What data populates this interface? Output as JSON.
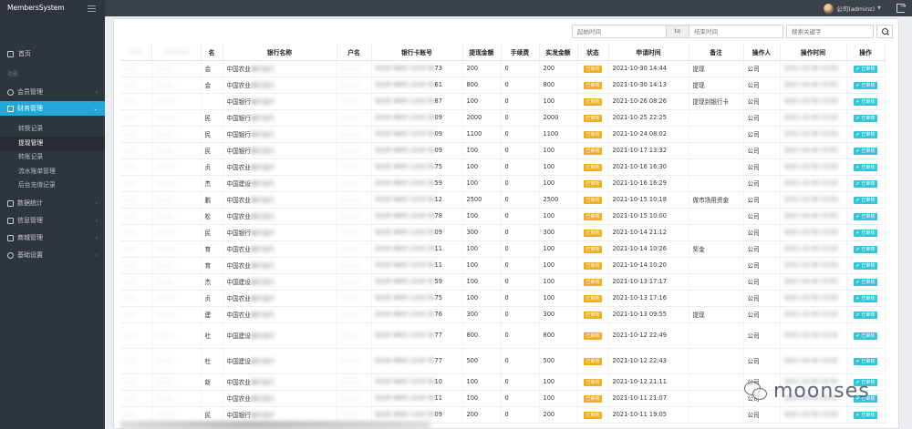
{
  "app": {
    "logo_text": "MembersSystem",
    "user_name": "公司(adminz)"
  },
  "sidebar": {
    "home": "首页",
    "section_label": "功能",
    "items": [
      {
        "label": "会员管理"
      },
      {
        "label": "财务管理"
      },
      {
        "label": "数据统计"
      },
      {
        "label": "信息管理"
      },
      {
        "label": "商城管理"
      },
      {
        "label": "基础设置"
      }
    ],
    "sub_items": [
      {
        "label": "转换记录"
      },
      {
        "label": "提现管理"
      },
      {
        "label": "转账记录"
      },
      {
        "label": "流水账单管理"
      },
      {
        "label": "后台充值记录"
      }
    ]
  },
  "filters": {
    "start_placeholder": "起始时间",
    "separator": "to",
    "end_placeholder": "结束时间",
    "keyword_placeholder": "搜索关键字"
  },
  "table": {
    "headers": {
      "name_tail": "名",
      "bank_name": "银行名称",
      "account_name": "户名",
      "card_no": "银行卡账号",
      "amount": "提现金额",
      "fee": "手续费",
      "actual": "实发金额",
      "status": "状态",
      "apply_time": "申请时间",
      "remark": "备注",
      "operator": "操作人",
      "op_time": "操作时间",
      "action": "操作"
    },
    "status_badge": "已审核",
    "action_label": "✔ 已审核",
    "rows": [
      {
        "name_tail": "会",
        "bank": "中国农业",
        "card_tail": "73",
        "amount": "200",
        "fee": "0",
        "actual": "200",
        "apply_time": "2021-10-30 14:44",
        "remark": "提现",
        "operator": "公司"
      },
      {
        "name_tail": "会",
        "bank": "中国农业",
        "card_tail": "61",
        "amount": "800",
        "fee": "0",
        "actual": "800",
        "apply_time": "2021-10-30 14:13",
        "remark": "提现",
        "operator": "公司"
      },
      {
        "name_tail": "",
        "bank": "中国银行",
        "card_tail": "87",
        "amount": "100",
        "fee": "0",
        "actual": "100",
        "apply_time": "2021-10-26 08:26",
        "remark": "提现到银行卡",
        "operator": "公司"
      },
      {
        "name_tail": "民",
        "bank": "中国银行",
        "card_tail": "09",
        "amount": "2000",
        "fee": "0",
        "actual": "2000",
        "apply_time": "2021-10-25 22:25",
        "remark": "",
        "operator": "公司"
      },
      {
        "name_tail": "民",
        "bank": "中国银行",
        "card_tail": "09",
        "amount": "1100",
        "fee": "0",
        "actual": "1100",
        "apply_time": "2021-10-24 08:02",
        "remark": "",
        "operator": "公司"
      },
      {
        "name_tail": "民",
        "bank": "中国银行",
        "card_tail": "09",
        "amount": "100",
        "fee": "0",
        "actual": "100",
        "apply_time": "2021-10-17 13:32",
        "remark": "",
        "operator": "公司"
      },
      {
        "name_tail": "贞",
        "bank": "中国农业",
        "card_tail": "75",
        "amount": "100",
        "fee": "0",
        "actual": "100",
        "apply_time": "2021-10-16 16:30",
        "remark": "",
        "operator": "公司"
      },
      {
        "name_tail": "杰",
        "bank": "中国建设",
        "card_tail": "59",
        "amount": "100",
        "fee": "0",
        "actual": "100",
        "apply_time": "2021-10-16 16:29",
        "remark": "",
        "operator": "公司"
      },
      {
        "name_tail": "鹏",
        "bank": "中国农业",
        "card_tail": "12",
        "amount": "2500",
        "fee": "0",
        "actual": "2500",
        "apply_time": "2021-10-15 10:18",
        "remark": "做市场用资金",
        "operator": "公司"
      },
      {
        "name_tail": "松",
        "bank": "中国农业",
        "card_tail": "78",
        "amount": "100",
        "fee": "0",
        "actual": "100",
        "apply_time": "2021-10-15 10:00",
        "remark": "",
        "operator": "公司"
      },
      {
        "name_tail": "民",
        "bank": "中国银行",
        "card_tail": "09",
        "amount": "300",
        "fee": "0",
        "actual": "300",
        "apply_time": "2021-10-14 21:12",
        "remark": "",
        "operator": "公司"
      },
      {
        "name_tail": "育",
        "bank": "中国农业",
        "card_tail": "11",
        "amount": "100",
        "fee": "0",
        "actual": "100",
        "apply_time": "2021-10-14 10:26",
        "remark": "奖金",
        "operator": "公司"
      },
      {
        "name_tail": "育",
        "bank": "中国农业",
        "card_tail": "11",
        "amount": "100",
        "fee": "0",
        "actual": "100",
        "apply_time": "2021-10-14 10:20",
        "remark": "",
        "operator": "公司"
      },
      {
        "name_tail": "杰",
        "bank": "中国建设",
        "card_tail": "59",
        "amount": "100",
        "fee": "0",
        "actual": "100",
        "apply_time": "2021-10-13 17:17",
        "remark": "",
        "operator": "公司"
      },
      {
        "name_tail": "贞",
        "bank": "中国农业",
        "card_tail": "75",
        "amount": "100",
        "fee": "0",
        "actual": "100",
        "apply_time": "2021-10-13 17:16",
        "remark": "",
        "operator": "公司"
      },
      {
        "name_tail": "建",
        "bank": "中国农业",
        "card_tail": "76",
        "amount": "300",
        "fee": "0",
        "actual": "300",
        "apply_time": "2021-10-13 09:55",
        "remark": "提现",
        "operator": "公司"
      },
      {
        "name_tail": "杜",
        "bank": "中国建设",
        "card_tail": "77",
        "amount": "800",
        "fee": "0",
        "actual": "800",
        "apply_time": "2021-10-12 22:49",
        "remark": "",
        "operator": "公司",
        "tall": true
      },
      {
        "name_tail": "杜",
        "bank": "中国建设",
        "card_tail": "77",
        "amount": "500",
        "fee": "0",
        "actual": "500",
        "apply_time": "2021-10-12 22:43",
        "remark": "",
        "operator": "公司",
        "tall": true
      },
      {
        "name_tail": "新",
        "bank": "中国农业",
        "card_tail": "10",
        "amount": "100",
        "fee": "0",
        "actual": "100",
        "apply_time": "2021-10-12 21:11",
        "remark": "",
        "operator": "公司"
      },
      {
        "name_tail": "",
        "bank": "中国农业",
        "card_tail": "11",
        "amount": "100",
        "fee": "0",
        "actual": "100",
        "apply_time": "2021-10-11 21:07",
        "remark": "",
        "operator": "公司"
      },
      {
        "name_tail": "民",
        "bank": "中国银行",
        "card_tail": "09",
        "amount": "200",
        "fee": "0",
        "actual": "200",
        "apply_time": "2021-10-11 19:05",
        "remark": "",
        "operator": "公司"
      }
    ]
  },
  "watermark": {
    "text": "moonses"
  },
  "colors": {
    "accent": "#20a8d8",
    "sidebar_bg": "#2f353d",
    "topbar_bg": "#3a4149",
    "badge": "#f0ad1e",
    "action": "#33c4d8"
  }
}
